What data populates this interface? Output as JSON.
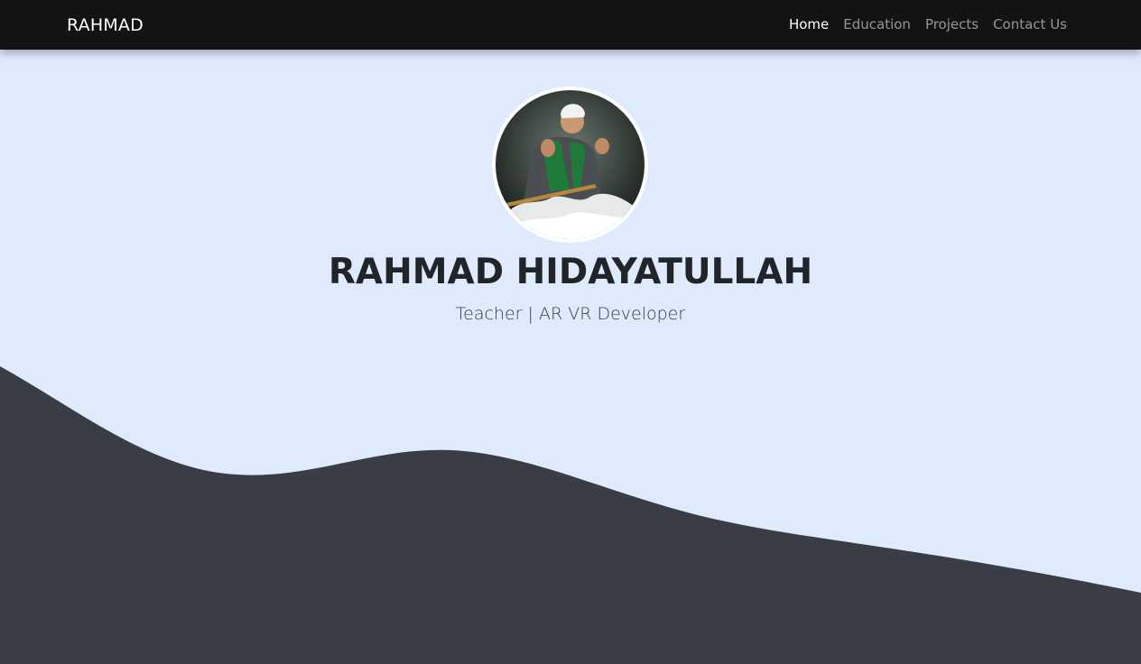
{
  "navbar": {
    "brand": "RAHMAD",
    "links": [
      {
        "label": "Home",
        "active": true
      },
      {
        "label": "Education",
        "active": false
      },
      {
        "label": "Projects",
        "active": false
      },
      {
        "label": "Contact Us",
        "active": false
      }
    ]
  },
  "hero": {
    "name": "RAHMAD HIDAYATULLAH",
    "tagline": "Teacher | AR VR Developer",
    "avatar": "profile-photo"
  },
  "colors": {
    "navbar_bg": "#131313",
    "hero_bg": "#e0eafd",
    "wave": "#3b3d46",
    "text_dark": "#212529"
  }
}
